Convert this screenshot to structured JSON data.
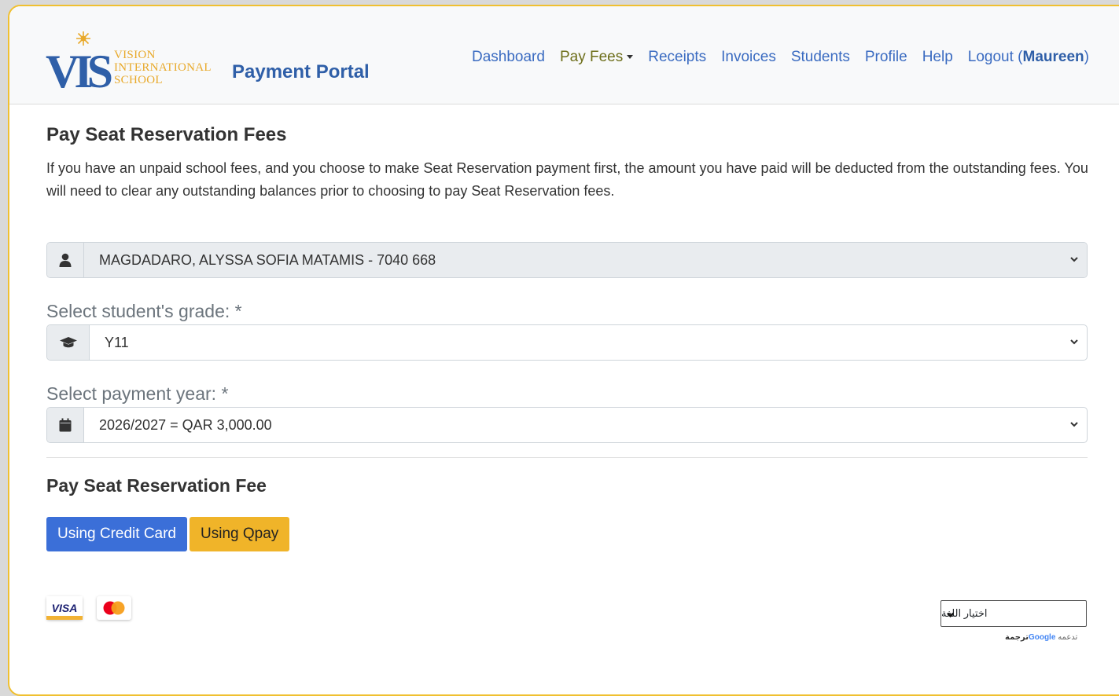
{
  "header": {
    "logo_lines": [
      "VISION",
      "INTERNATIONAL",
      "SCHOOL"
    ],
    "brand": "Payment Portal",
    "nav": [
      {
        "label": "Dashboard"
      },
      {
        "label": "Pay Fees"
      },
      {
        "label": "Receipts"
      },
      {
        "label": "Invoices"
      },
      {
        "label": "Students"
      },
      {
        "label": "Profile"
      },
      {
        "label": "Help"
      }
    ],
    "logout_label": "Logout (",
    "logout_user": "Maureen",
    "logout_close": ")"
  },
  "page": {
    "title": "Pay Seat Reservation Fees",
    "description": "If you have an unpaid school fees, and you choose to make Seat Reservation payment first, the amount you have paid will be deducted from the outstanding fees. You will need to clear any outstanding balances prior to choosing to pay Seat Reservation fees."
  },
  "form": {
    "student": {
      "value": "MAGDADARO, ALYSSA SOFIA MATAMIS - 7040 668",
      "icon": "user-icon"
    },
    "grade": {
      "label": "Select student's grade: *",
      "value": "Y11",
      "icon": "graduation-cap-icon"
    },
    "year": {
      "label": "Select payment year: *",
      "value": "2026/2027 = QAR 3,000.00",
      "icon": "calendar-icon"
    }
  },
  "payment": {
    "heading": "Pay Seat Reservation Fee",
    "credit_card_label": "Using Credit Card",
    "qpay_label": "Using Qpay",
    "visa_text": "VISA"
  },
  "translate": {
    "select_value": "اختيار اللغة",
    "powered_prefix": "تدعمه",
    "google": "Google",
    "translate_word": "ترجمة"
  },
  "colors": {
    "primary": "#3b6fd8",
    "qpay": "#f0b429",
    "brand_gold": "#e8a92a",
    "brand_blue": "#2f5fa8"
  }
}
